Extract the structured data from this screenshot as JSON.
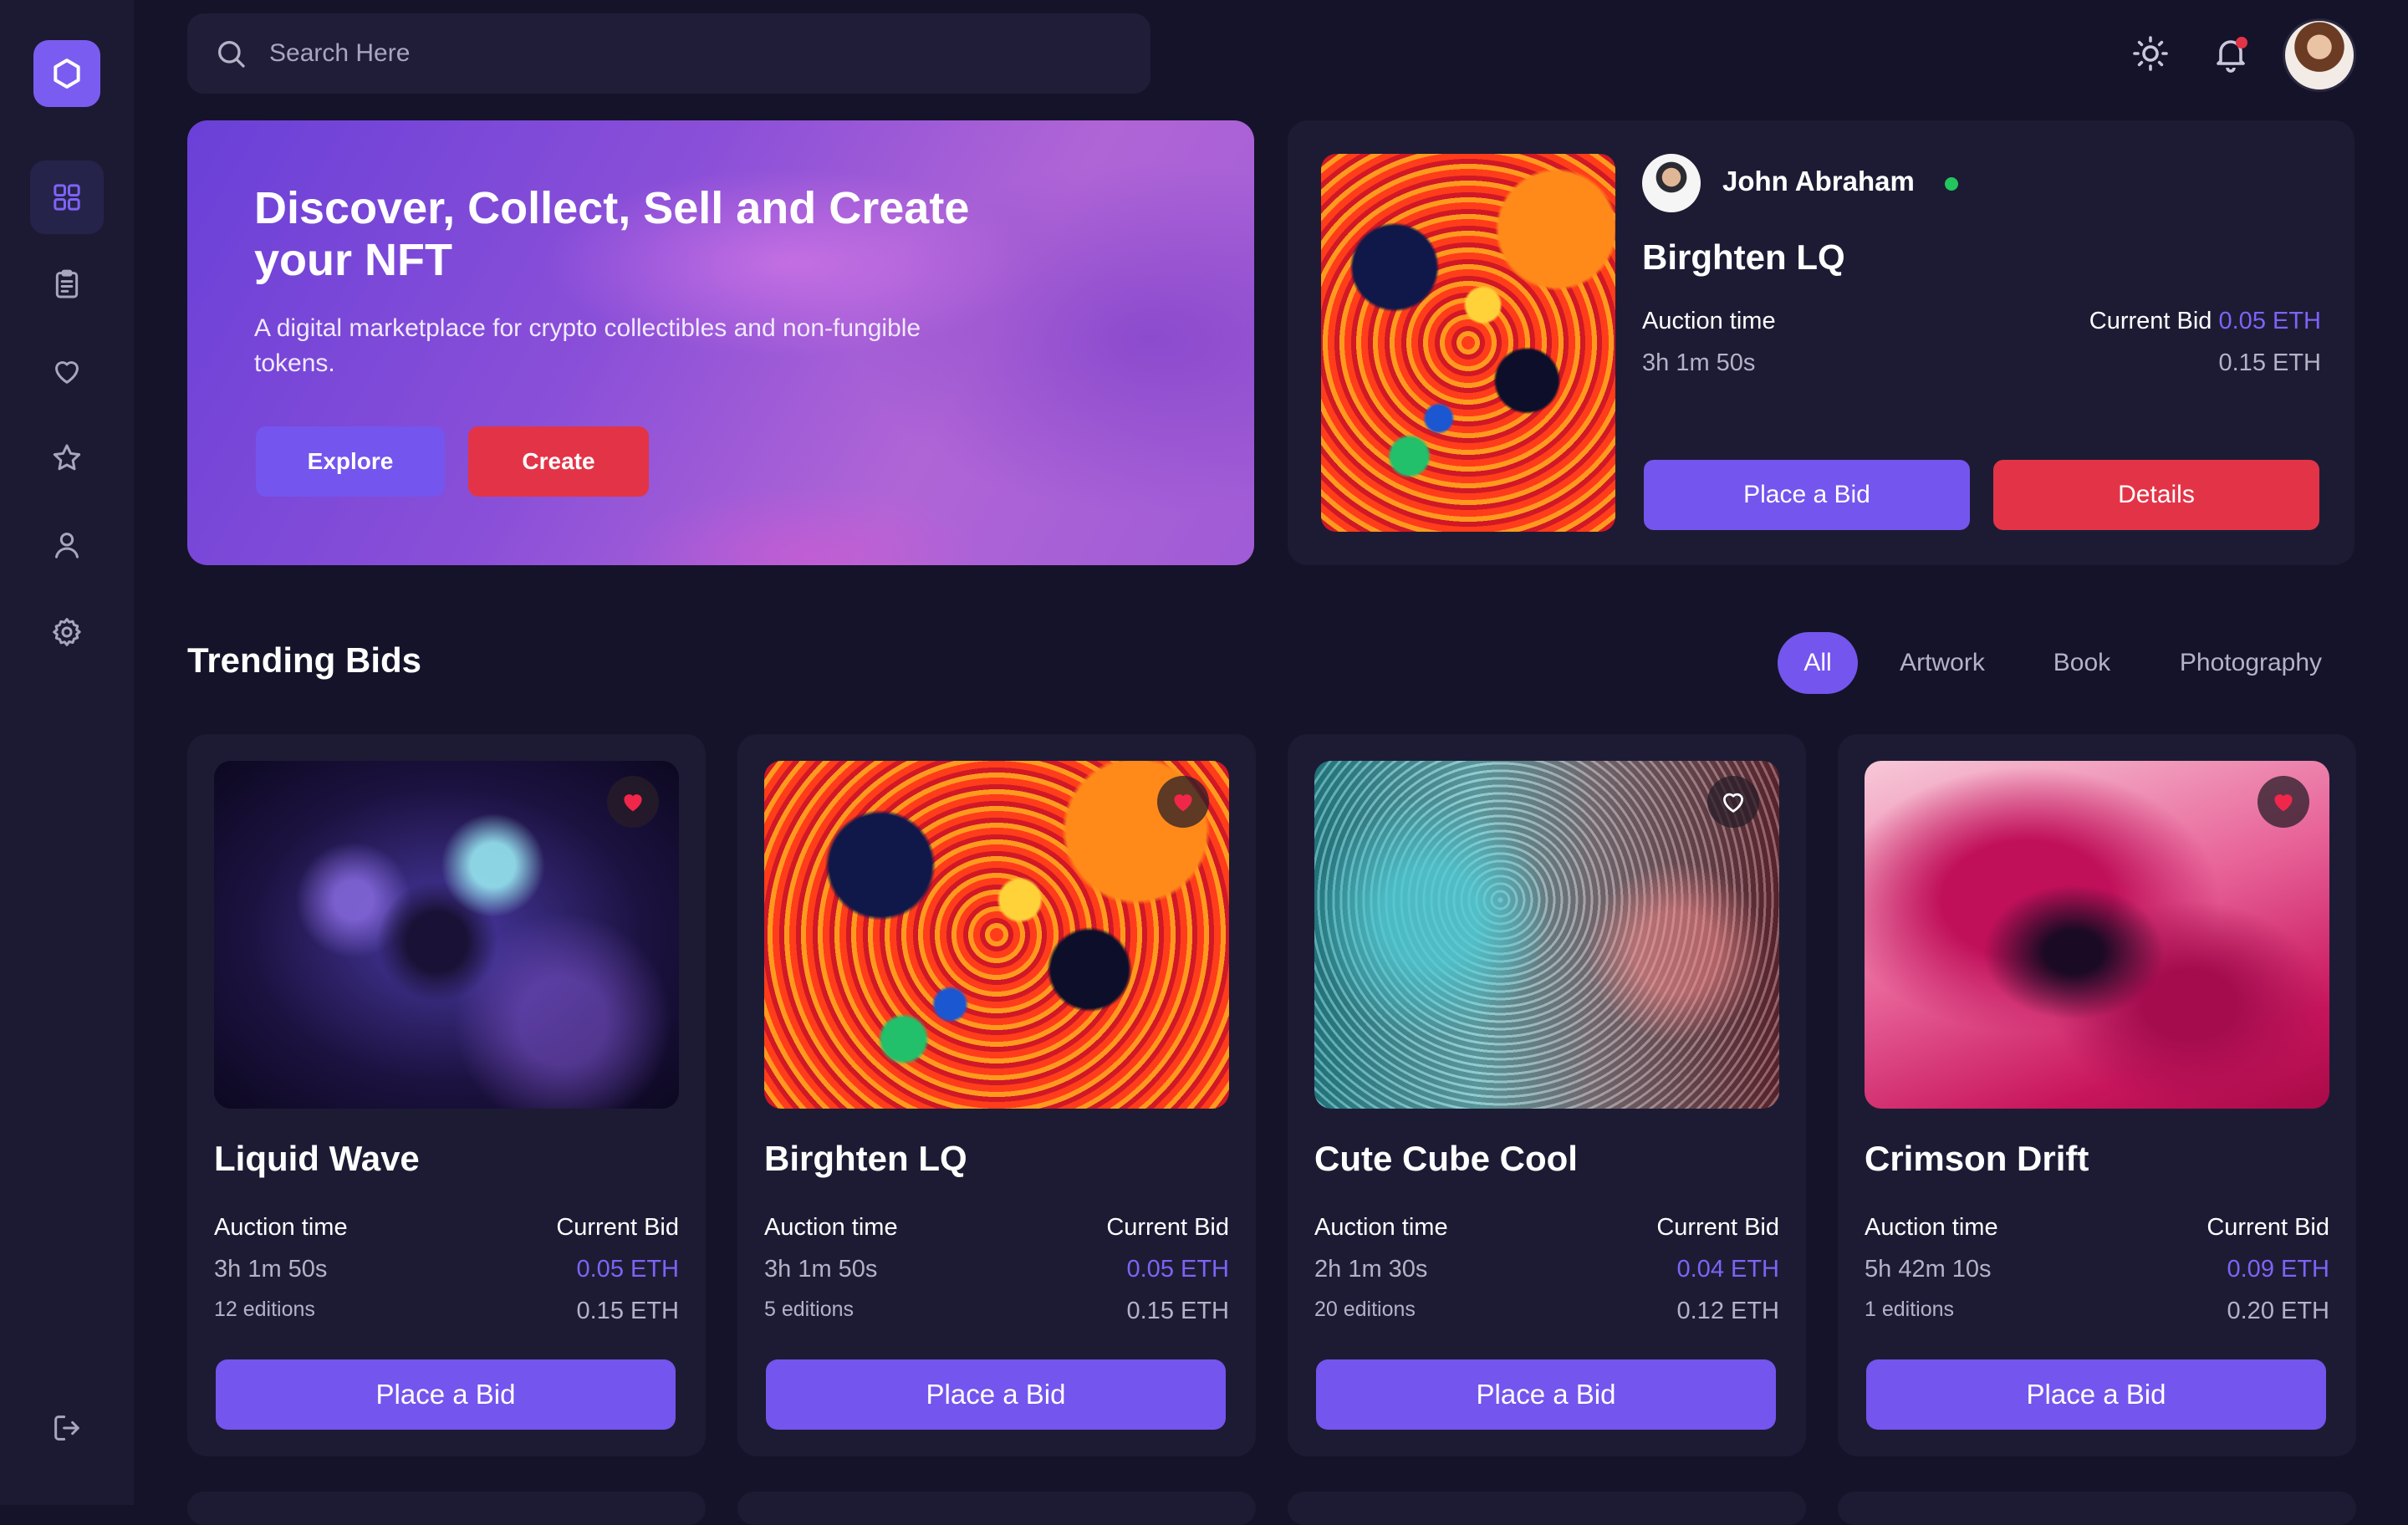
{
  "search": {
    "placeholder": "Search Here"
  },
  "sidebar": {
    "items": [
      {
        "icon": "dashboard-icon",
        "active": true
      },
      {
        "icon": "clipboard-icon"
      },
      {
        "icon": "heart-icon"
      },
      {
        "icon": "star-icon"
      },
      {
        "icon": "user-icon"
      },
      {
        "icon": "gear-icon"
      }
    ],
    "logout_icon": "logout-icon"
  },
  "hero": {
    "title": "Discover, Collect, Sell and Create your NFT",
    "subtitle": "A digital marketplace for crypto collectibles and non-fungible tokens.",
    "explore_label": "Explore",
    "create_label": "Create"
  },
  "featured": {
    "user_name": "John Abraham",
    "title": "Birghten LQ",
    "auction_label": "Auction time",
    "auction_time": "3h 1m 50s",
    "current_bid_label": "Current Bid",
    "current_bid": "0.05 ETH",
    "base_price": "0.15 ETH",
    "bid_label": "Place a Bid",
    "details_label": "Details"
  },
  "trending": {
    "title": "Trending Bids",
    "tabs": [
      {
        "label": "All",
        "active": true
      },
      {
        "label": "Artwork"
      },
      {
        "label": "Book"
      },
      {
        "label": "Photography"
      }
    ],
    "cards": [
      {
        "title": "Liquid Wave",
        "auction_label": "Auction time",
        "auction_time": "3h 1m 50s",
        "editions": "12 editions",
        "current_bid_label": "Current Bid",
        "current_bid": "0.05 ETH",
        "base_price": "0.15 ETH",
        "bid_label": "Place a Bid",
        "liked": true
      },
      {
        "title": "Birghten LQ",
        "auction_label": "Auction time",
        "auction_time": "3h 1m 50s",
        "editions": "5 editions",
        "current_bid_label": "Current Bid",
        "current_bid": "0.05 ETH",
        "base_price": "0.15 ETH",
        "bid_label": "Place a Bid",
        "liked": true
      },
      {
        "title": "Cute Cube Cool",
        "auction_label": "Auction time",
        "auction_time": "2h 1m 30s",
        "editions": "20 editions",
        "current_bid_label": "Current Bid",
        "current_bid": "0.04 ETH",
        "base_price": "0.12 ETH",
        "bid_label": "Place a Bid",
        "liked": false
      },
      {
        "title": "Crimson Drift",
        "auction_label": "Auction time",
        "auction_time": "5h 42m 10s",
        "editions": "1 editions",
        "current_bid_label": "Current Bid",
        "current_bid": "0.09 ETH",
        "base_price": "0.20 ETH",
        "bid_label": "Place a Bid",
        "liked": true
      }
    ]
  },
  "colors": {
    "background": "#151329",
    "surface": "#1d1b34",
    "accent": "#7455ee",
    "danger": "#e33447",
    "online": "#22c55e"
  }
}
